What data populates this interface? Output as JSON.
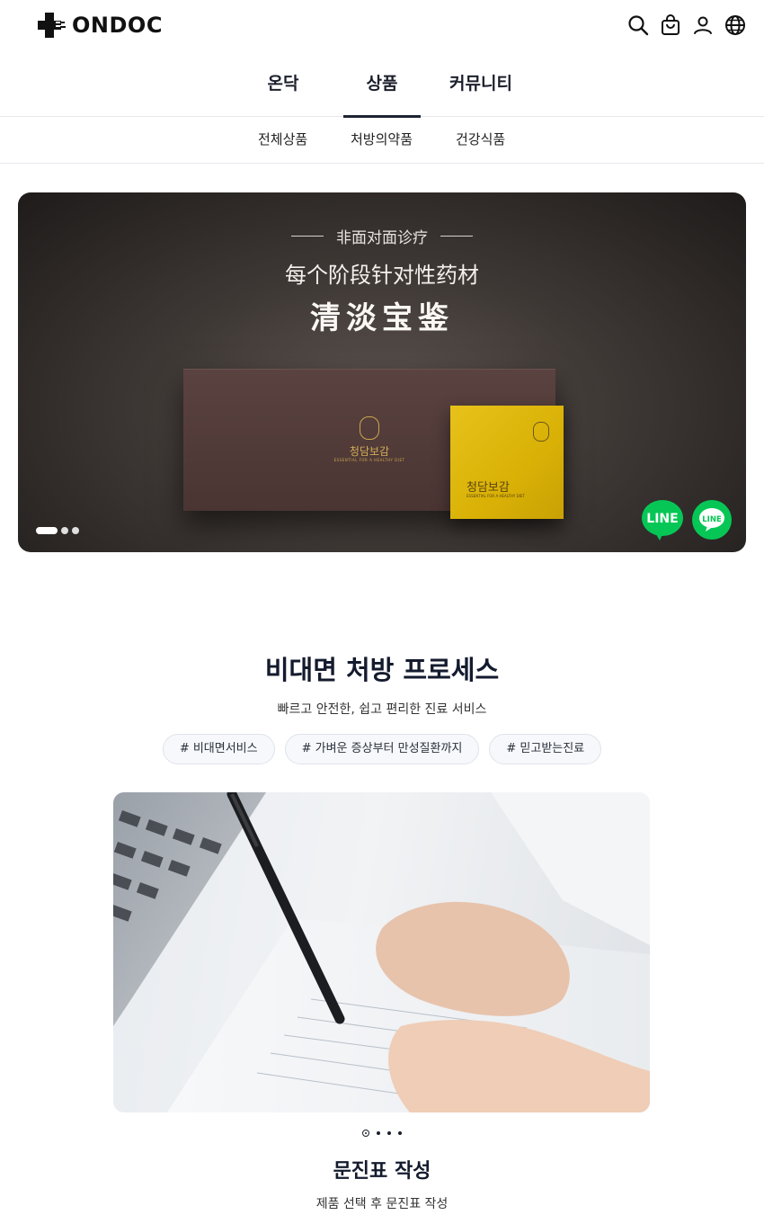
{
  "header": {
    "logo_text": "ONDOC",
    "icons": [
      "search-icon",
      "shopping-bag-icon",
      "user-icon",
      "globe-icon"
    ]
  },
  "main_nav": {
    "tabs": [
      {
        "label": "온닥",
        "active": false
      },
      {
        "label": "상품",
        "active": true
      },
      {
        "label": "커뮤니티",
        "active": false
      }
    ]
  },
  "sub_nav": {
    "tabs": [
      {
        "label": "전체상품"
      },
      {
        "label": "처방의약품"
      },
      {
        "label": "건강식품"
      }
    ]
  },
  "banner": {
    "subtitle": "非面对面诊疗",
    "title": "每个阶段针对性药材",
    "brand": "清淡宝鉴",
    "box_name": "청담보감",
    "box_tagline": "ESSENTIAL FOR A HEALTHY DIET",
    "pouch_name": "청담보감",
    "pouch_tagline": "ESSENTIAL FOR A HEALTHY DIET",
    "slide_count": 3,
    "active_slide": 1,
    "line_label": "LINE",
    "colors": {
      "line_green": "#06c755",
      "pouch_yellow": "#e2bc12"
    }
  },
  "process": {
    "title": "비대면 처방 프로세스",
    "subtitle": "빠르고 안전한, 쉽고 편리한 진료 서비스",
    "hashtags": [
      "# 비대면서비스",
      "# 가벼운 증상부터 만성질환까지",
      "# 믿고받는진료"
    ],
    "step_count": 4,
    "active_step": 1,
    "step_title": "문진표 작성",
    "step_desc": "제품 선택 후 문진표 작성"
  }
}
